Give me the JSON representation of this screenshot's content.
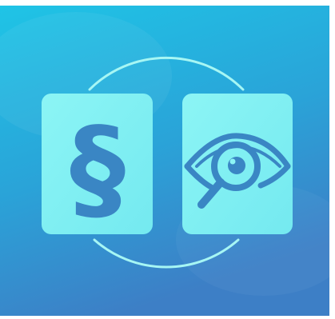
{
  "image": {
    "kind": "app-icon",
    "left_card": {
      "icon": "section-sign-icon",
      "glyph": "§"
    },
    "right_card": {
      "icon": "eye-magnifier-icon"
    },
    "colors": {
      "background_top": "#22c3e4",
      "background_bottom": "#3b85c9",
      "card_fill": "#7ef0f2",
      "glyph_color": "#3a86c4",
      "ring_color": "#9ff3f3"
    }
  }
}
